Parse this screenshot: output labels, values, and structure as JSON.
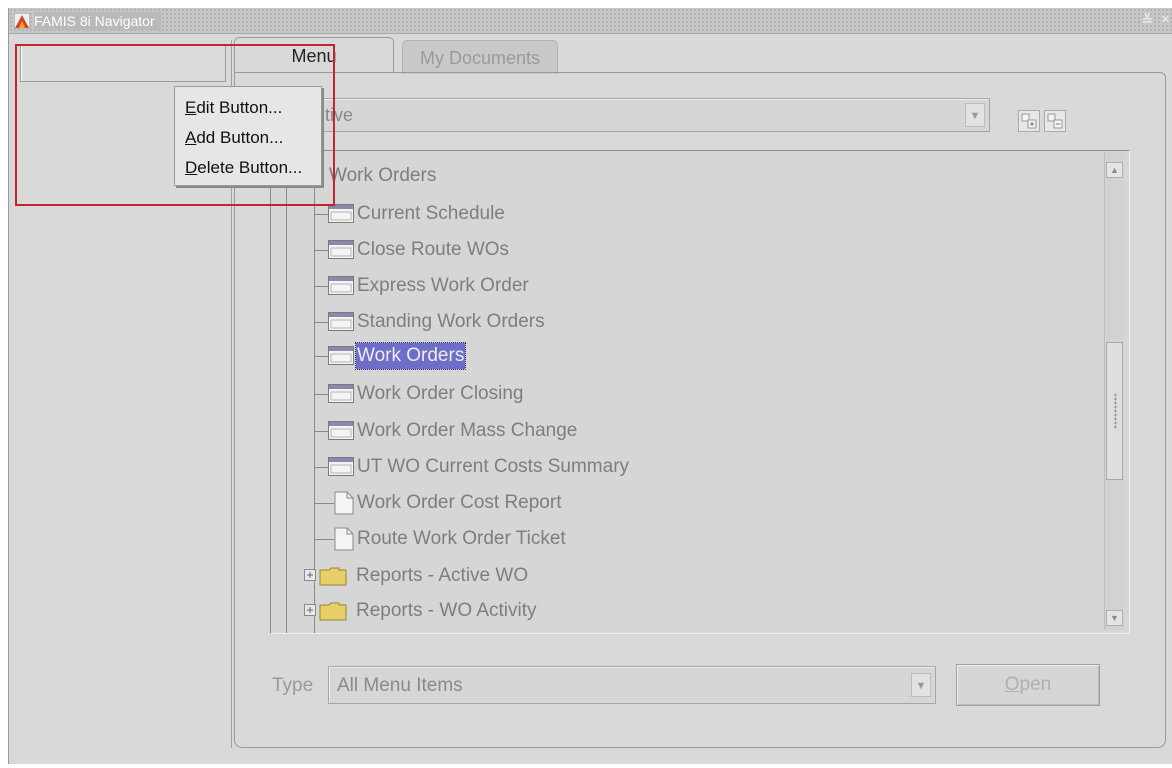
{
  "window": {
    "title": "FAMIS 8i Navigator",
    "controls": [
      "≚",
      "×"
    ]
  },
  "tabs": [
    {
      "label_prefix": "Me",
      "label_suffix": "nu"
    },
    {
      "label": "My Documents"
    }
  ],
  "menu_combo": {
    "value": "tive"
  },
  "tree": {
    "root": "Work Orders",
    "items": [
      {
        "label": "Current Schedule",
        "icon": "form-icon"
      },
      {
        "label": "Close Route WOs",
        "icon": "form-icon"
      },
      {
        "label": "Express Work Order",
        "icon": "form-icon"
      },
      {
        "label": "Standing Work Orders",
        "icon": "form-icon"
      },
      {
        "label": "Work Orders",
        "icon": "form-icon",
        "selected": true
      },
      {
        "label": "Work Order Closing",
        "icon": "form-icon"
      },
      {
        "label": "Work Order Mass Change",
        "icon": "form-icon"
      },
      {
        "label": "UT WO Current Costs Summary",
        "icon": "form-icon"
      },
      {
        "label": "Work Order Cost Report",
        "icon": "document-icon"
      },
      {
        "label": "Route Work Order Ticket",
        "icon": "document-icon"
      },
      {
        "label": "Reports - Active WO",
        "icon": "folder-icon"
      },
      {
        "label": "Reports - WO Activity",
        "icon": "folder-icon"
      }
    ]
  },
  "type_filter": {
    "label": "Type",
    "value": "All Menu Items"
  },
  "open_button": {
    "accel": "O",
    "rest": "pen"
  },
  "context_menu": {
    "items": [
      {
        "accel": "E",
        "rest": "dit Button..."
      },
      {
        "accel": "A",
        "rest": "dd Button..."
      },
      {
        "accel": "D",
        "rest": "elete Button..."
      }
    ]
  },
  "colors": {
    "selection": "#6e6ec8",
    "annotation_box": "#c0272d",
    "window_bg": "#d9d9d9"
  }
}
